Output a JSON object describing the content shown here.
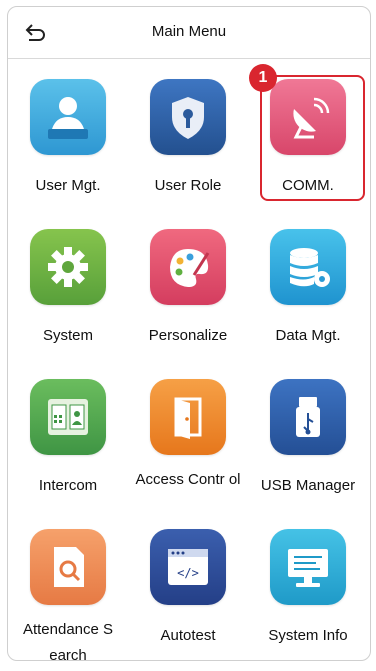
{
  "header": {
    "title": "Main Menu"
  },
  "selection": {
    "badge": "1"
  },
  "menu": [
    {
      "label": "User Mgt.",
      "icon": "user-management-icon",
      "color": "#39a9dd"
    },
    {
      "label": "User Role",
      "icon": "user-role-shield-icon",
      "color": "#2f5fa9"
    },
    {
      "label": "COMM.",
      "icon": "communication-dish-icon",
      "color": "#e35c7b"
    },
    {
      "label": "System",
      "icon": "system-gear-icon",
      "color": "#6db23f"
    },
    {
      "label": "Personalize",
      "icon": "personalize-palette-icon",
      "color": "#e14e6b"
    },
    {
      "label": "Data Mgt.",
      "icon": "data-management-icon",
      "color": "#2aa9dc"
    },
    {
      "label": "Intercom",
      "icon": "intercom-icon",
      "color": "#53a84a"
    },
    {
      "label": "Access Contr ol",
      "icon": "access-control-door-icon",
      "color": "#ef8a28"
    },
    {
      "label": "USB Manager",
      "icon": "usb-icon",
      "color": "#2e5ea8"
    },
    {
      "label": "Attendance S earch",
      "icon": "attendance-search-icon",
      "color": "#f08a55"
    },
    {
      "label": "Autotest",
      "icon": "autotest-icon",
      "color": "#2f4f9b"
    },
    {
      "label": "System Info",
      "icon": "system-info-monitor-icon",
      "color": "#26b0d6"
    }
  ]
}
